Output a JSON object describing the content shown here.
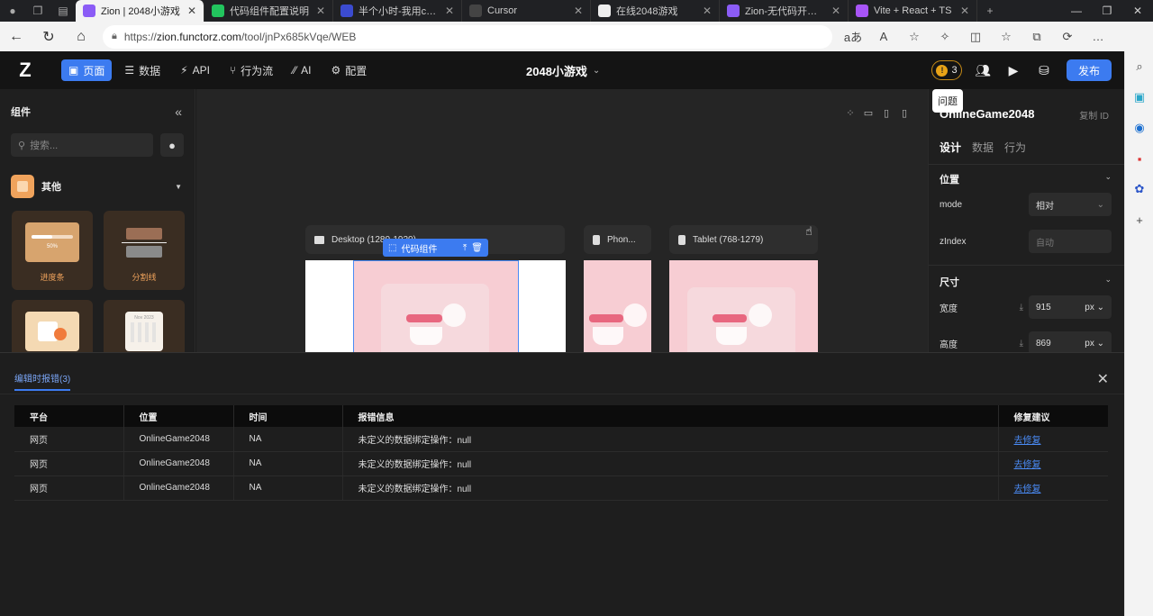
{
  "browser": {
    "tabs": [
      {
        "title": "Zion | 2048小游戏",
        "active": true,
        "favcolor": "#8b5cf6"
      },
      {
        "title": "代码组件配置说明",
        "active": false,
        "favcolor": "#22c55e"
      },
      {
        "title": "半个小时-我用cursor",
        "active": false,
        "favcolor": "#3b4bd0"
      },
      {
        "title": "Cursor",
        "active": false,
        "favcolor": "#444444"
      },
      {
        "title": "在线2048游戏",
        "active": false,
        "favcolor": "#eeeeee"
      },
      {
        "title": "Zion-无代码开发-毛",
        "active": false,
        "favcolor": "#8b5cf6"
      },
      {
        "title": "Vite + React + TS",
        "active": false,
        "favcolor": "#a855f7"
      }
    ],
    "url_prefix": "https://",
    "url_host": "zion.functorz.com",
    "url_path": "/tool/jnPx685kVqe/WEB"
  },
  "header": {
    "logo": "Z",
    "menu": [
      {
        "label": "页面",
        "icon": "▣",
        "active": true
      },
      {
        "label": "数据",
        "icon": "☰",
        "active": false
      },
      {
        "label": "API",
        "icon": "⚡",
        "active": false
      },
      {
        "label": "行为流",
        "icon": "⑂",
        "active": false
      },
      {
        "label": "AI",
        "icon": "⁄⁄",
        "active": false
      },
      {
        "label": "配置",
        "icon": "⚙",
        "active": false
      }
    ],
    "project_title": "2048小游戏",
    "issue_count": "3",
    "issue_dot": "!",
    "tooltip": "问题",
    "publish_label": "发布"
  },
  "left_panel": {
    "title": "组件",
    "search_placeholder": "搜索...",
    "category": "其他",
    "components": [
      {
        "label": "进度条",
        "progress": 50,
        "progress_text": "50%"
      },
      {
        "label": "分割线"
      },
      {
        "label": ""
      },
      {
        "label": "",
        "calendar_text": "Nov 2023"
      }
    ]
  },
  "canvas": {
    "frames": [
      {
        "label": "Desktop (1280-1920)"
      },
      {
        "label": "Phon..."
      },
      {
        "label": "Tablet (768-1279)"
      }
    ],
    "selected_chip": "代码组件"
  },
  "right_panel": {
    "component_name": "OnlineGame2048",
    "copy_id": "复制 ID",
    "tabs": [
      "设计",
      "数据",
      "行为"
    ],
    "position_section": "位置",
    "mode_label": "mode",
    "mode_value": "相对",
    "zindex_label": "zIndex",
    "zindex_placeholder": "自动",
    "size_section": "尺寸",
    "width_label": "宽度",
    "width_value": "915",
    "height_label": "高度",
    "height_value": "869",
    "unit": "px"
  },
  "error_panel": {
    "tab_label": "编辑时报错(3)",
    "columns": [
      "平台",
      "位置",
      "时间",
      "报错信息",
      "修复建议"
    ],
    "rows": [
      [
        "网页",
        "OnlineGame2048",
        "NA",
        "未定义的数据绑定操作：null",
        "去修复"
      ],
      [
        "网页",
        "OnlineGame2048",
        "NA",
        "未定义的数据绑定操作：null",
        "去修复"
      ],
      [
        "网页",
        "OnlineGame2048",
        "NA",
        "未定义的数据绑定操作：null",
        "去修复"
      ]
    ]
  },
  "colors": {
    "accent": "#3c7bf0",
    "warning": "#e8a317",
    "preview_pink": "#f7cdd3",
    "component_accent": "#f0a35c"
  }
}
